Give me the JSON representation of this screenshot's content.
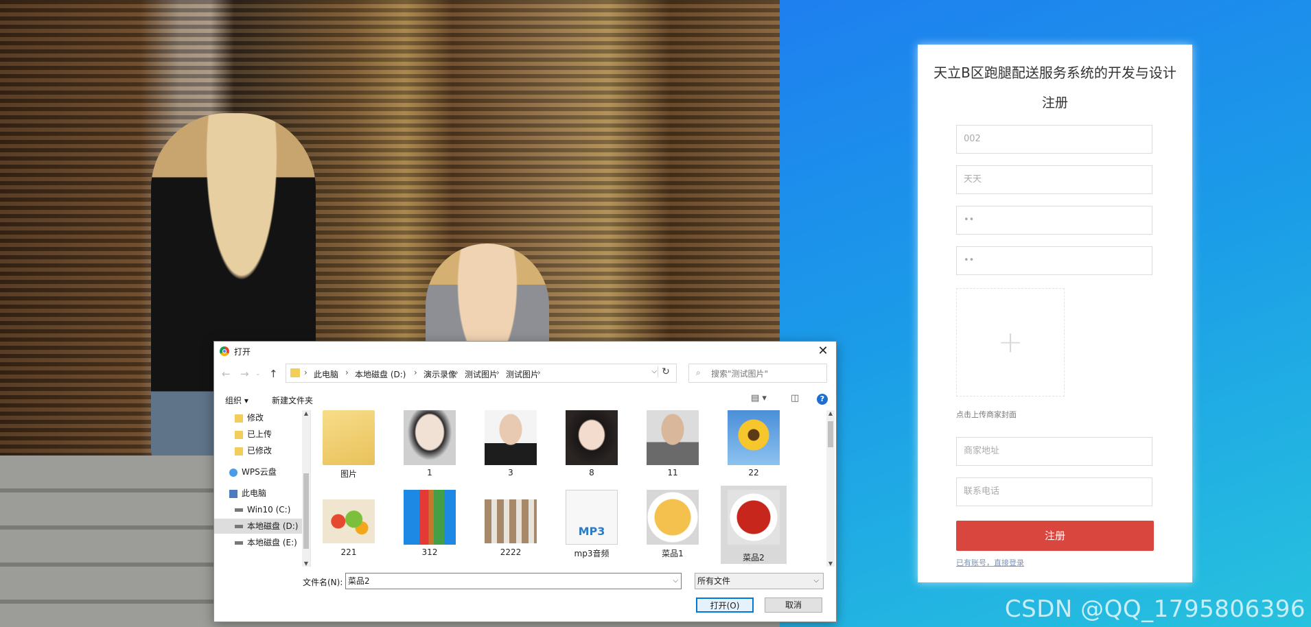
{
  "register": {
    "title": "天立B区跑腿配送服务系统的开发与设计",
    "subtitle": "注册",
    "fields": [
      "002",
      "天天",
      "••",
      "••"
    ],
    "upload_plus": "+",
    "upload_hint": "点击上传商家封面",
    "address_placeholder": "商家地址",
    "phone_placeholder": "联系电话",
    "submit_label": "注册",
    "login_link": "已有账号，直接登录"
  },
  "dialog": {
    "title": "打开",
    "close": "✕",
    "breadcrumbs": [
      "此电脑",
      "本地磁盘 (D:)",
      "演示录像",
      "测试图片",
      "测试图片"
    ],
    "search_placeholder": "搜索\"测试图片\"",
    "toolbar": {
      "organize": "组织 ▾",
      "new_folder": "新建文件夹",
      "help": "?"
    },
    "nav": [
      {
        "label": "修改",
        "icon": "folder"
      },
      {
        "label": "已上传",
        "icon": "folder"
      },
      {
        "label": "已修改",
        "icon": "folder"
      },
      {
        "label": "WPS云盘",
        "icon": "cloud"
      },
      {
        "label": "此电脑",
        "icon": "pc"
      },
      {
        "label": "Win10 (C:)",
        "icon": "drive"
      },
      {
        "label": "本地磁盘 (D:)",
        "icon": "drive"
      },
      {
        "label": "本地磁盘 (E:)",
        "icon": "drive"
      }
    ],
    "files": [
      {
        "name": "图片",
        "kind": "folder"
      },
      {
        "name": "1",
        "kind": "photo"
      },
      {
        "name": "3",
        "kind": "photo"
      },
      {
        "name": "8",
        "kind": "photo"
      },
      {
        "name": "11",
        "kind": "photo"
      },
      {
        "name": "22",
        "kind": "sunflower"
      },
      {
        "name": "221",
        "kind": "veg"
      },
      {
        "name": "312",
        "kind": "archive"
      },
      {
        "name": "2222",
        "kind": "bottles"
      },
      {
        "name": "mp3音频",
        "kind": "mp3"
      },
      {
        "name": "菜品1",
        "kind": "dish"
      },
      {
        "name": "菜品2",
        "kind": "crayfish"
      }
    ],
    "filename_label": "文件名(N):",
    "filename_value": "菜品2",
    "filetype_value": "所有文件",
    "open_label": "打开(O)",
    "cancel_label": "取消"
  },
  "watermark": "CSDN @QQ_1795806396"
}
